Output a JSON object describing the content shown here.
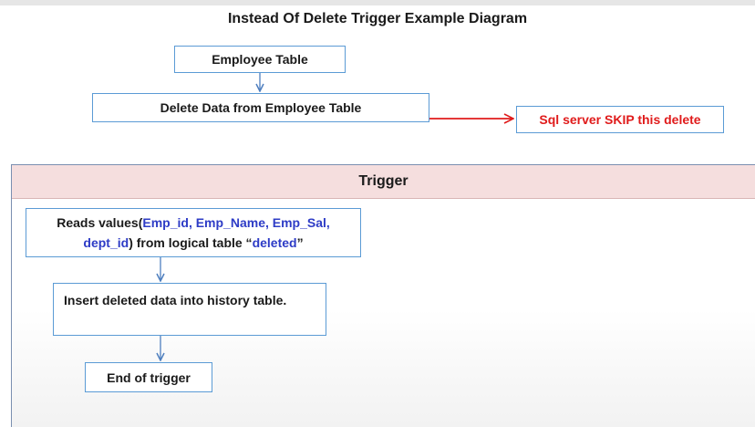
{
  "diagram": {
    "title": "Instead Of Delete Trigger Example Diagram",
    "nodes": {
      "employee_table": "Employee Table",
      "delete_data": "Delete Data from Employee Table",
      "skip_delete": "Sql server SKIP this delete",
      "trigger_header": "Trigger",
      "reads_values": {
        "prefix": "Reads values(",
        "fields": "Emp_id, Emp_Name, Emp_Sal,",
        "field_last": "dept_id",
        "middle": ") from logical table “",
        "table": "deleted",
        "suffix": "”"
      },
      "insert_history": "Insert deleted data into history table.",
      "end_trigger": "End of trigger"
    },
    "colors": {
      "box_border": "#5b9bd5",
      "arrow_blue": "#4f7fbf",
      "arrow_red": "#e01b1b",
      "skip_text": "#e01b1b",
      "highlight_text": "#2e3cc6",
      "trigger_header_bg": "#f5dede"
    }
  }
}
